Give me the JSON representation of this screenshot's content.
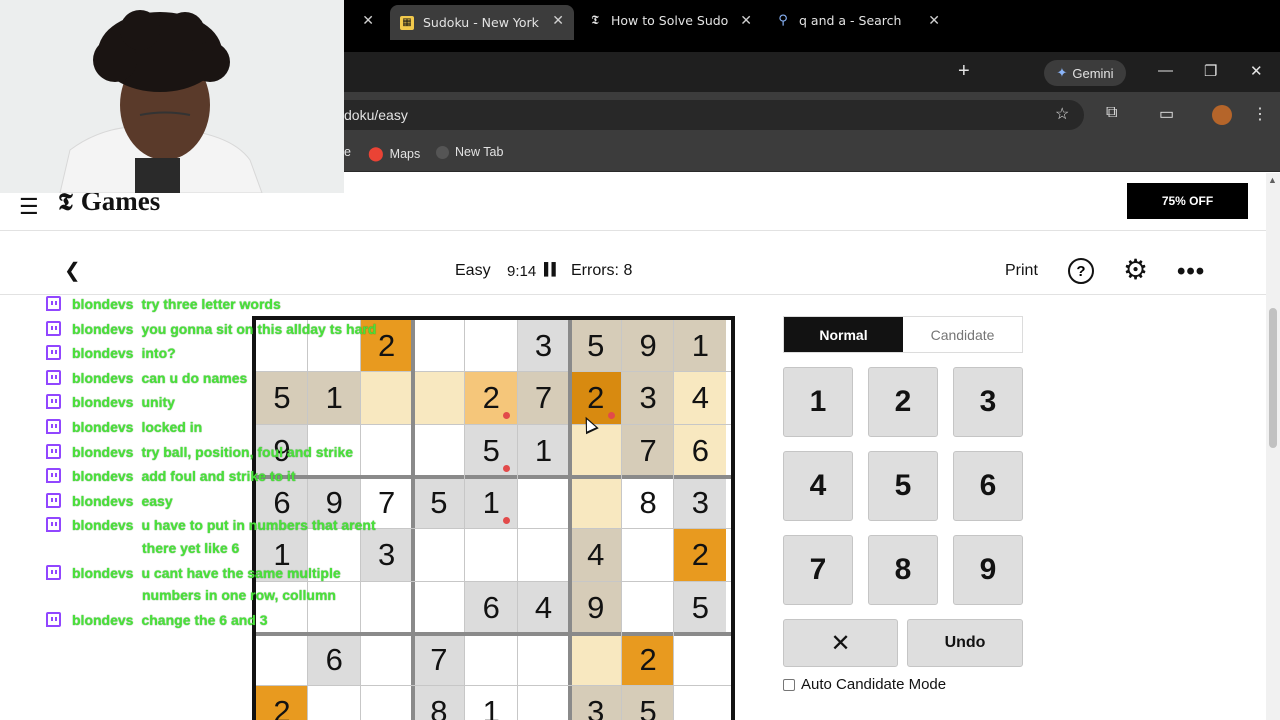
{
  "browser": {
    "tabs": [
      {
        "title": "Sudoku - New York Times",
        "icon": "nyt-games-icon",
        "active": true
      },
      {
        "title": "How to Solve Sudoku",
        "icon": "nyt-icon",
        "active": false
      },
      {
        "title": "q and a - Search",
        "icon": "search-icon",
        "active": false
      }
    ],
    "gemini_label": "Gemini",
    "url": "doku/easy",
    "bookmarks": [
      {
        "label": "e"
      },
      {
        "label": "Maps"
      },
      {
        "label": "New Tab"
      }
    ]
  },
  "site": {
    "brand": "Games",
    "subscribe_label": "75% OFF"
  },
  "toolbar": {
    "level": "Easy",
    "timer": "9:14",
    "errors": "Errors: 8",
    "print_label": "Print"
  },
  "board": {
    "rows": [
      [
        "",
        "",
        "2",
        "",
        "",
        "3",
        "5",
        "9",
        "1"
      ],
      [
        "5",
        "1",
        "",
        "",
        "2",
        "7",
        "2",
        "3",
        "4"
      ],
      [
        "9",
        "",
        "",
        "",
        "5",
        "1",
        "",
        "7",
        "6"
      ],
      [
        "6",
        "9",
        "7",
        "5",
        "1",
        "",
        "",
        "8",
        "3"
      ],
      [
        "1",
        "",
        "3",
        "",
        "",
        "",
        "4",
        "",
        "2"
      ],
      [
        "",
        "",
        "",
        "",
        "6",
        "4",
        "9",
        "",
        "5"
      ],
      [
        "",
        "6",
        "",
        "7",
        "",
        "",
        "",
        "2",
        ""
      ],
      [
        "2",
        "",
        "",
        "8",
        "1",
        "",
        "3",
        "5",
        ""
      ]
    ],
    "shades": [
      [
        "w",
        "w",
        "o",
        "w",
        "w",
        "g",
        "t",
        "t",
        "t"
      ],
      [
        "t",
        "t",
        "c",
        "c",
        "p",
        "t",
        "O",
        "t",
        "c"
      ],
      [
        "g",
        "w",
        "w",
        "w",
        "g",
        "g",
        "c",
        "t",
        "c"
      ],
      [
        "g",
        "g",
        "w",
        "g",
        "g",
        "w",
        "c",
        "w",
        "g"
      ],
      [
        "g",
        "w",
        "g",
        "w",
        "w",
        "w",
        "t",
        "w",
        "o"
      ],
      [
        "w",
        "w",
        "w",
        "w",
        "g",
        "g",
        "t",
        "w",
        "g"
      ],
      [
        "w",
        "g",
        "w",
        "g",
        "w",
        "w",
        "c",
        "o",
        "w"
      ],
      [
        "o",
        "w",
        "w",
        "g",
        "w",
        "w",
        "t",
        "t",
        "w"
      ]
    ],
    "error_dots": [
      [
        1,
        4
      ],
      [
        1,
        6
      ],
      [
        2,
        4
      ],
      [
        3,
        4
      ]
    ],
    "colors": {
      "w": "#ffffff",
      "g": "#dcdcdc",
      "t": "#d6ccb8",
      "c": "#f8e8c0",
      "o": "#e89a1f",
      "O": "#d88a10",
      "p": "#f5c67a"
    }
  },
  "chat": [
    {
      "user": "blondevs",
      "text": "try three letter words"
    },
    {
      "user": "blondevs",
      "text": "you gonna sit on this allday ts hard"
    },
    {
      "user": "blondevs",
      "text": "into?"
    },
    {
      "user": "blondevs",
      "text": "can u do names"
    },
    {
      "user": "blondevs",
      "text": "unity"
    },
    {
      "user": "blondevs",
      "text": "locked in"
    },
    {
      "user": "blondevs",
      "text": "try ball, position, foul and strike"
    },
    {
      "user": "blondevs",
      "text": "add foul and strike to it"
    },
    {
      "user": "blondevs",
      "text": "easy"
    },
    {
      "user": "blondevs",
      "text": "u have to put in numbers that arent",
      "cont": "there yet like 6"
    },
    {
      "user": "blondevs",
      "text": "u cant have the same multiple",
      "cont": "numbers in one row, collumn"
    },
    {
      "user": "blondevs",
      "text": "change the 6 and 3"
    }
  ],
  "panel": {
    "modes": [
      "Normal",
      "Candidate"
    ],
    "active_mode": "Normal",
    "numbers": [
      "1",
      "2",
      "3",
      "4",
      "5",
      "6",
      "7",
      "8",
      "9"
    ],
    "erase_label": "✕",
    "undo_label": "Undo",
    "auto_candidate_label": "Auto Candidate Mode"
  }
}
